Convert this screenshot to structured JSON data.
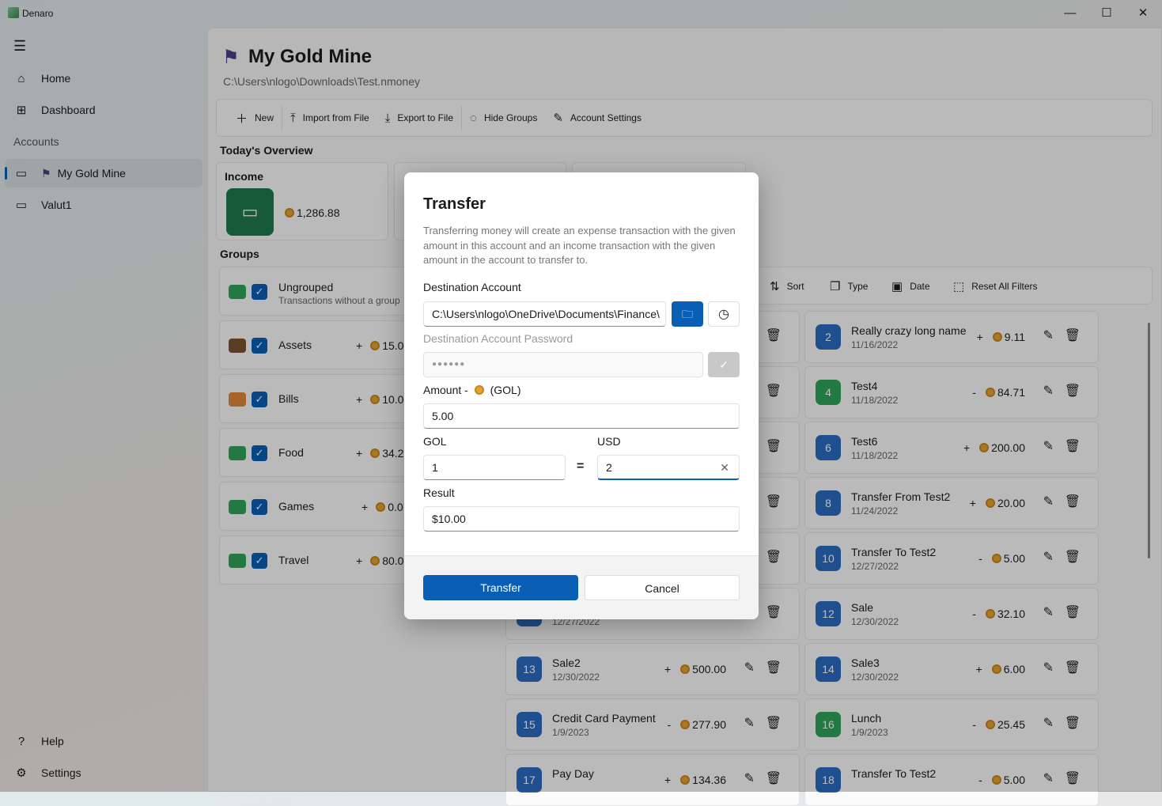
{
  "window": {
    "title": "Denaro",
    "minimize": "—",
    "maximize": "☐",
    "close": "✕"
  },
  "sidebar": {
    "items": [
      {
        "label": "Home",
        "icon": "⌂"
      },
      {
        "label": "Dashboard",
        "icon": "⊞"
      }
    ],
    "accounts_header": "Accounts",
    "accounts": [
      {
        "label": "My Gold Mine",
        "selected": true
      },
      {
        "label": "Valut1",
        "selected": false
      }
    ],
    "help": "Help",
    "settings": "Settings"
  },
  "header": {
    "title": "My Gold Mine",
    "path": "C:\\Users\\nlogo\\Downloads\\Test.nmoney"
  },
  "toolbar": {
    "new": "New",
    "import": "Import from File",
    "export": "Export to File",
    "hide_groups": "Hide Groups",
    "account_settings": "Account Settings"
  },
  "overview": {
    "title": "Today's Overview",
    "income_label": "Income",
    "income_value": "1,286.88"
  },
  "groups": {
    "title": "Groups",
    "items": [
      {
        "name": "Ungrouped",
        "subtitle": "Transactions without a group",
        "color": "#2ea55a",
        "amount": ""
      },
      {
        "name": "Assets",
        "color": "#7a5230",
        "sign": "+",
        "amount": "15.0"
      },
      {
        "name": "Bills",
        "color": "#e0883a",
        "sign": "+",
        "amount": "10.0"
      },
      {
        "name": "Food",
        "color": "#2ea55a",
        "sign": "+",
        "amount": "34.2"
      },
      {
        "name": "Games",
        "color": "#2ea55a",
        "sign": "+",
        "amount": "0.0"
      },
      {
        "name": "Travel",
        "color": "#2ea55a",
        "sign": "+",
        "amount": "80.0"
      }
    ]
  },
  "filters": {
    "sort": "Sort",
    "type": "Type",
    "date": "Date",
    "reset": "Reset All Filters"
  },
  "transactions": [
    {
      "id": "",
      "name": "",
      "date": "",
      "sign": "",
      "amount": "",
      "color": "#2b6bc2"
    },
    {
      "id": "2",
      "name": "Really crazy long name",
      "date": "11/16/2022",
      "sign": "+",
      "amount": "9.11",
      "color": "#2b6bc2"
    },
    {
      "id": "",
      "name": "",
      "date": "",
      "sign": "",
      "amount": "",
      "color": "#2b6bc2"
    },
    {
      "id": "4",
      "name": "Test4",
      "date": "11/18/2022",
      "sign": "-",
      "amount": "84.71",
      "color": "#2ea55a"
    },
    {
      "id": "",
      "name": "",
      "date": "",
      "sign": "",
      "amount": "",
      "color": "#2b6bc2"
    },
    {
      "id": "6",
      "name": "Test6",
      "date": "11/18/2022",
      "sign": "+",
      "amount": "200.00",
      "color": "#2b6bc2"
    },
    {
      "id": "",
      "name": "",
      "date": "",
      "sign": "",
      "amount": "",
      "color": "#2b6bc2"
    },
    {
      "id": "8",
      "name": "Transfer From Test2",
      "date": "11/24/2022",
      "sign": "+",
      "amount": "20.00",
      "color": "#2b6bc2"
    },
    {
      "id": "",
      "name": "",
      "date": "",
      "sign": "",
      "amount": "",
      "color": "#2b6bc2"
    },
    {
      "id": "10",
      "name": "Transfer To Test2",
      "date": "12/27/2022",
      "sign": "-",
      "amount": "5.00",
      "color": "#2b6bc2"
    },
    {
      "id": "",
      "name": "",
      "date": "12/27/2022",
      "sign": "",
      "amount": "",
      "color": "#2b6bc2"
    },
    {
      "id": "12",
      "name": "Sale",
      "date": "12/30/2022",
      "sign": "-",
      "amount": "32.10",
      "color": "#2b6bc2"
    },
    {
      "id": "13",
      "name": "Sale2",
      "date": "12/30/2022",
      "sign": "+",
      "amount": "500.00",
      "color": "#2b6bc2"
    },
    {
      "id": "14",
      "name": "Sale3",
      "date": "12/30/2022",
      "sign": "+",
      "amount": "6.00",
      "color": "#2b6bc2"
    },
    {
      "id": "15",
      "name": "Credit Card Payment",
      "date": "1/9/2023",
      "sign": "-",
      "amount": "277.90",
      "color": "#2b6bc2"
    },
    {
      "id": "16",
      "name": "Lunch",
      "date": "1/9/2023",
      "sign": "-",
      "amount": "25.45",
      "color": "#2ea55a"
    },
    {
      "id": "17",
      "name": "Pay Day",
      "date": "",
      "sign": "+",
      "amount": "134.36",
      "color": "#2b6bc2"
    },
    {
      "id": "18",
      "name": "Transfer To Test2",
      "date": "",
      "sign": "-",
      "amount": "5.00",
      "color": "#2b6bc2"
    }
  ],
  "dialog": {
    "title": "Transfer",
    "description": "Transferring money will create an expense transaction with the given amount in this account and an income transaction with the given amount in the account to transfer to.",
    "destination_label": "Destination Account",
    "destination_value": "C:\\Users\\nlogo\\OneDrive\\Documents\\Finance\\",
    "password_label": "Destination Account Password",
    "password_value": "●●●●●●",
    "amount_label_prefix": "Amount -",
    "amount_label_suffix": "(GOL)",
    "amount_value": "5.00",
    "from_currency": "GOL",
    "to_currency": "USD",
    "from_rate": "1",
    "equals": "=",
    "to_rate": "2",
    "result_label": "Result",
    "result_value": "$10.00",
    "transfer": "Transfer",
    "cancel": "Cancel"
  },
  "colors": {
    "accent": "#0a5fb4",
    "income": "#1e7a4f"
  }
}
